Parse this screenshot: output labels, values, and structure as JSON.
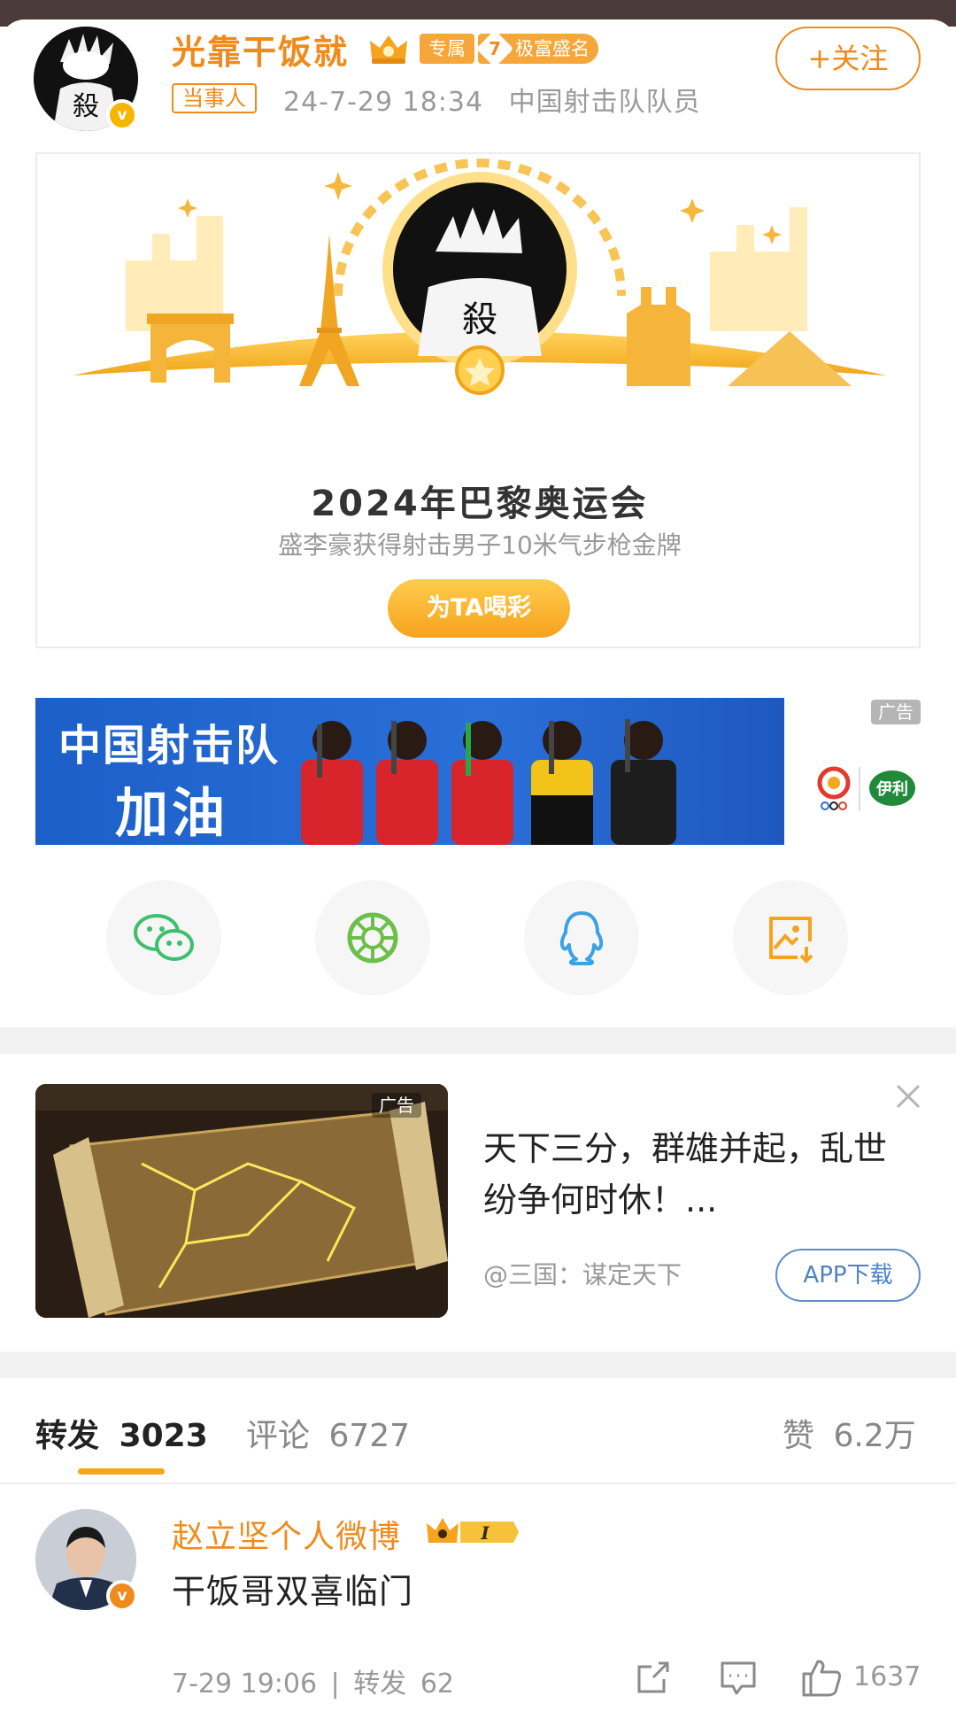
{
  "post": {
    "author_name": "光靠干饭就",
    "tag_exclusive": "专属",
    "tag_rich_level": "7",
    "tag_rich_label": "极富盛名",
    "follow_label": "+关注",
    "party_tag": "当事人",
    "timestamp": "24-7-29 18:34",
    "author_title": "中国射击队队员",
    "avatar_glyph": "殺",
    "verified_glyph": "v"
  },
  "olympic_card": {
    "title": "2024年巴黎奥运会",
    "subtitle": "盛李豪获得射击男子10米气步枪金牌",
    "button_label": "为TA喝彩"
  },
  "banner_ad": {
    "line1": "中国射击队",
    "line2": "加油",
    "ad_label": "广告",
    "brand_mark": "伊利"
  },
  "share": {
    "items": [
      {
        "icon": "wechat-icon"
      },
      {
        "icon": "moments-icon"
      },
      {
        "icon": "qq-icon"
      },
      {
        "icon": "save-image-icon"
      }
    ]
  },
  "game_ad": {
    "ad_label": "广告",
    "text": "天下三分，群雄并起，乱世纷争何时休！...",
    "source": "@三国：谋定天下",
    "button_label": "APP下载"
  },
  "tabs": {
    "repost_label": "转发",
    "repost_count": "3023",
    "comment_label": "评论",
    "comment_count": "6727",
    "like_label": "赞",
    "like_count": "6.2万"
  },
  "comment": {
    "author": "赵立坚个人微博",
    "level": "I",
    "verified_glyph": "v",
    "text": "干饭哥双喜临门",
    "time": "7-29 19:06",
    "separator": "|",
    "repost_label": "转发",
    "repost_count": "62",
    "likes": "1637"
  },
  "colors": {
    "accent_orange": "#f08a1c",
    "gold": "#f6a31d",
    "banner_blue": "#1c5fc9",
    "link_blue": "#4d82c7"
  }
}
